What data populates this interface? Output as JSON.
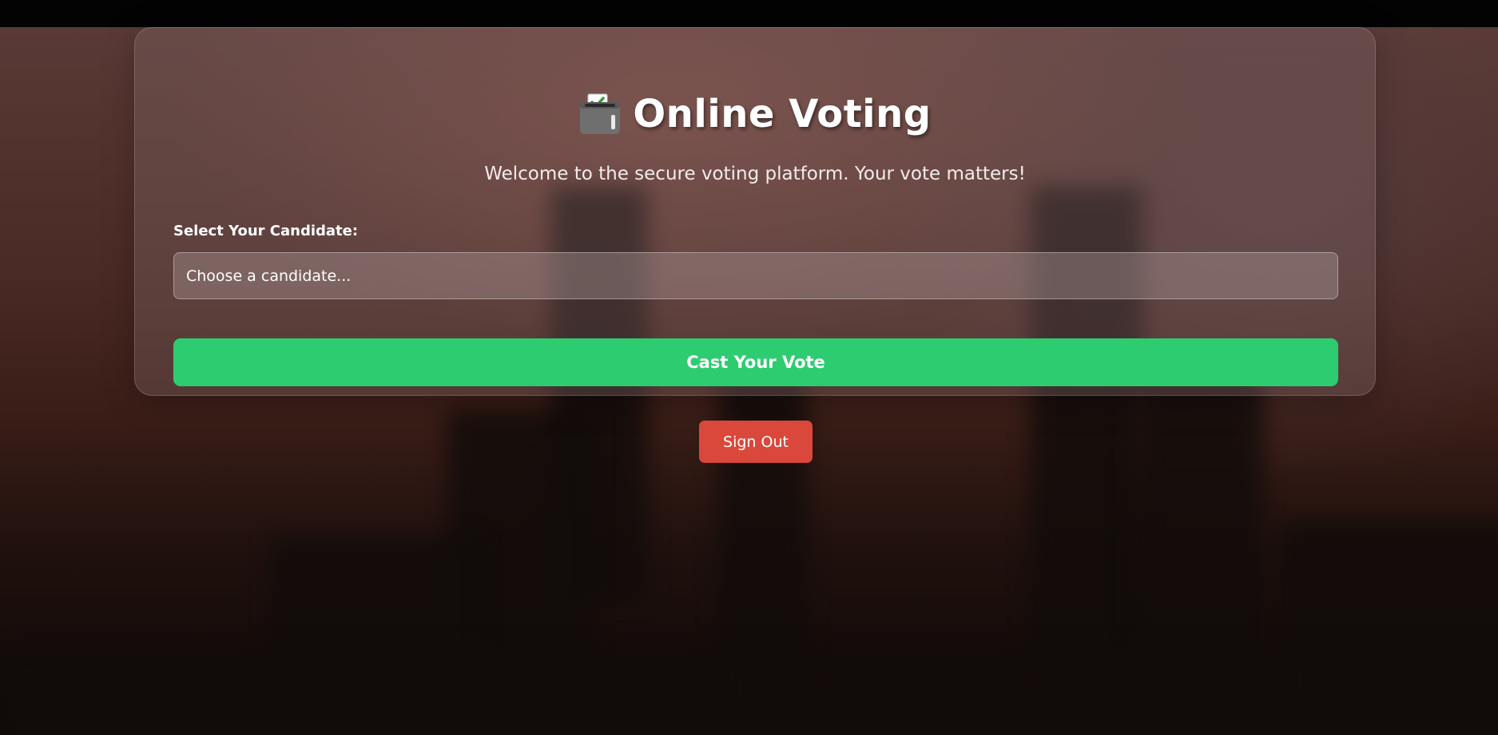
{
  "app": {
    "title": "Online Voting",
    "title_icon": "ballot-box-with-check-icon",
    "subtitle": "Welcome to the secure voting platform. Your vote matters!"
  },
  "form": {
    "candidate_label": "Select Your Candidate:",
    "candidate_placeholder": "Choose a candidate...",
    "submit_label": "Cast Your Vote"
  },
  "actions": {
    "sign_out_label": "Sign Out"
  },
  "colors": {
    "vote_button": "#2ecc71",
    "sign_out_button": "#d9483b"
  }
}
